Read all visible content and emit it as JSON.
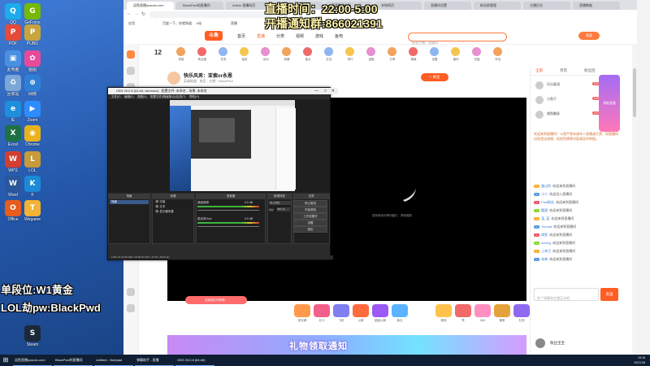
{
  "overlay": {
    "schedule": "直播时间：22:00-5:00",
    "notify_group": "开播通知群:866021391",
    "rank": "单段位:W1黄金",
    "password": "LOL劫pw:BlackPwd"
  },
  "desktop": {
    "icons": [
      {
        "label": "QQ",
        "color": "#1eabe9",
        "glyph": "Q"
      },
      {
        "label": "GeForce",
        "color": "#76b900",
        "glyph": "G"
      },
      {
        "label": "PDF",
        "color": "#e44b3a",
        "glyph": "P"
      },
      {
        "label": "PUBG",
        "color": "#c7a53c",
        "glyph": "P"
      },
      {
        "label": "此电脑",
        "color": "#4a90e2",
        "glyph": "▣"
      },
      {
        "label": "画图",
        "color": "#e84a9a",
        "glyph": "✿"
      },
      {
        "label": "回收站",
        "color": "#7aa7d8",
        "glyph": "♻"
      },
      {
        "label": "网络",
        "color": "#2f7fd6",
        "glyph": "⊕"
      },
      {
        "label": "IE",
        "color": "#1f8fdd",
        "glyph": "e"
      },
      {
        "label": "Zoom",
        "color": "#2d8cff",
        "glyph": "▶"
      },
      {
        "label": "Excel",
        "color": "#1e7145",
        "glyph": "X"
      },
      {
        "label": "Chrome",
        "color": "#e8b31c",
        "glyph": "◉"
      },
      {
        "label": "WPS",
        "color": "#d23f31",
        "glyph": "W"
      },
      {
        "label": "LOL",
        "color": "#c79a3a",
        "glyph": "L"
      },
      {
        "label": "Word",
        "color": "#2b579a",
        "glyph": "W"
      },
      {
        "label": "K",
        "color": "#1c8ad6",
        "glyph": "K"
      },
      {
        "label": "Office",
        "color": "#e85c1c",
        "glyph": "O"
      },
      {
        "label": "Wegame",
        "color": "#f2b233",
        "glyph": "T"
      },
      {
        "label": "Steam",
        "color": "#1b2838",
        "glyph": "S"
      }
    ]
  },
  "browser": {
    "tabs": [
      {
        "label": "逗鱼直播/pwudo.com"
      },
      {
        "label": "BlackPwd的直播间"
      },
      {
        "label": "Article 直播网页"
      },
      {
        "label": "虎牙直播"
      },
      {
        "label": "直播数据分析"
      },
      {
        "label": "本地网页"
      },
      {
        "label": "直播间设置"
      },
      {
        "label": "粉丝群管理"
      },
      {
        "label": "主播后台"
      },
      {
        "label": "直播数据"
      }
    ],
    "url": "douyu.com/5071",
    "bookmarks": [
      "应用",
      "百度一下，你就知道",
      "b站",
      "直播",
      "淘宝",
      "翻译",
      "邮箱",
      "工具"
    ],
    "site": {
      "logo": "斗鱼",
      "nav": [
        "首页",
        "直播",
        "分类",
        "视频",
        "游戏",
        "鱼吧"
      ],
      "active_nav": "直播",
      "search_placeholder": "搜索主播、直播间",
      "search_button": "搜索"
    },
    "room": {
      "number": "12",
      "title": "快乐风男：亚索or永恩",
      "subtitle": "英雄联盟 · 电竞 · 主播：BlackPwd",
      "follow": "+ 关注"
    },
    "gift_row": [
      "贵族",
      "粉丝团",
      "任务",
      "抽奖",
      "活动",
      "竞猜",
      "鱼丸",
      "红包",
      "排行",
      "宝箱",
      "分享",
      "弹幕",
      "设置",
      "福利",
      "充值",
      "好友"
    ],
    "bottom_gifts": [
      "荧光棒",
      "办卡",
      "飞机",
      "火箭",
      "超级火箭",
      "鱼丸",
      "弱鸡",
      "赞",
      "666",
      "辣条",
      "礼物"
    ],
    "bottom_note": "当前送礼可获得：",
    "banner_text": "礼物领取通知",
    "chat": {
      "tabs": [
        "全部",
        "贵宾",
        "粉丝团"
      ],
      "top_users": [
        {
          "name": "乐乐星语",
          "badge": "LV12"
        },
        {
          "name": "小鱼干",
          "badge": "LV9"
        },
        {
          "name": "咸鱼翻身",
          "badge": "LV7"
        }
      ],
      "announcement": "欢迎来到直播间！斗鱼严禁未成年人直播或打赏，如直播间出现违法违规、低俗色情等内容请及时举报。",
      "messages": [
        {
          "user": "路过的",
          "text": "欢迎来到直播间"
        },
        {
          "user": "小二",
          "text": "欢迎进入直播间"
        },
        {
          "user": "Pwd粉丝",
          "text": "欢迎来到直播间"
        },
        {
          "user": "酸甜",
          "text": "欢迎来到直播间"
        },
        {
          "user": "某_某",
          "text": "欢迎来到直播间"
        },
        {
          "user": "Tomcat",
          "text": "欢迎来到直播间"
        },
        {
          "user": "咸鱼",
          "text": "欢迎来到直播间"
        },
        {
          "user": "w1dog",
          "text": "欢迎来到直播间"
        },
        {
          "user": "上单王",
          "text": "欢迎来到直播间"
        },
        {
          "user": "劫神",
          "text": "欢迎来到直播间"
        }
      ],
      "input_placeholder": "发个弹幕和主播互动吧",
      "send": "发送",
      "bottom_user": "粉丝宝宝",
      "promo": "领取奖励"
    }
  },
  "obs": {
    "title": "OBS 25.0.8 (64-bit, windows) - 配置文件: 未命名 - 场景: 未命名",
    "menu": [
      "文件(F)",
      "编辑(E)",
      "视图(V)",
      "配置文件(P)",
      "场景集合(S)",
      "工具(T)",
      "帮助(H)"
    ],
    "docks": [
      "场景",
      "来源",
      "混音器",
      "转场特效",
      "控件"
    ],
    "scene": "场景",
    "sources": [
      "字幕",
      "文本",
      "显示器采集"
    ],
    "mixer": [
      {
        "name": "桌面音频",
        "db": "0.0 dB"
      },
      {
        "name": "麦克风/Aux",
        "db": "0.0 dB"
      }
    ],
    "transition": "淡入淡出",
    "duration_label": "时长",
    "duration": "300 ms",
    "controls": [
      "停止推流",
      "开始录制",
      "工作室模式",
      "设置",
      "退出"
    ],
    "status": "LIVE: 01:23:45   REC: 00:00:00   CPU: 12.3%, 30.00 fps"
  },
  "player_caption": "鼠标拖动可移动窗口，滚轮缩放",
  "taskbar": {
    "items": [
      "逗鱼直播/pwudo.com",
      "BlackPwd的直播间",
      "Untitled - Notepad",
      "弹幕助手 - 直播",
      "OBS 25.0.8 (64-bit)"
    ],
    "time": "23:15",
    "date": "2021/1/8"
  }
}
